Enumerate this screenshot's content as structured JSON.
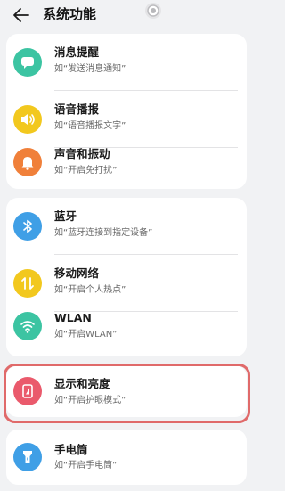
{
  "header": {
    "title": "系统功能",
    "back_icon": "arrow-left-icon",
    "status_icon": "ring-icon"
  },
  "groups": [
    {
      "items": [
        {
          "key": "message",
          "name": "消息提醒",
          "desc": "如“发送消息通知”",
          "icon": "chat-bubble-icon",
          "color": "#3cc4a2"
        },
        {
          "key": "voice",
          "name": "语音播报",
          "desc": "如“语音播报文字”",
          "icon": "speaker-icon",
          "color": "#f2c81e"
        },
        {
          "key": "sound",
          "name": "声音和振动",
          "desc": "如“开启免打扰”",
          "icon": "bell-icon",
          "color": "#f0803a"
        }
      ]
    },
    {
      "items": [
        {
          "key": "bluetooth",
          "name": "蓝牙",
          "desc": "如“蓝牙连接到指定设备”",
          "icon": "bluetooth-icon",
          "color": "#3f9fe6"
        },
        {
          "key": "mobile",
          "name": "移动网络",
          "desc": "如“开启个人热点”",
          "icon": "mobile-data-icon",
          "color": "#f2c81e"
        },
        {
          "key": "wlan",
          "name": "WLAN",
          "desc": "如“开启WLAN”",
          "icon": "wifi-icon",
          "color": "#3cc4a2"
        }
      ]
    },
    {
      "items": [
        {
          "key": "display",
          "name": "显示和亮度",
          "desc": "如“开启护眼模式”",
          "icon": "display-brightness-icon",
          "color": "#ea5a6c"
        }
      ]
    },
    {
      "items": [
        {
          "key": "flashlight",
          "name": "手电筒",
          "desc": "如“开启手电筒”",
          "icon": "flashlight-icon",
          "color": "#3f9fe6"
        }
      ]
    }
  ],
  "colors": {
    "background": "#f1f2f4",
    "card": "#ffffff",
    "highlight_border": "#e06a6a"
  }
}
